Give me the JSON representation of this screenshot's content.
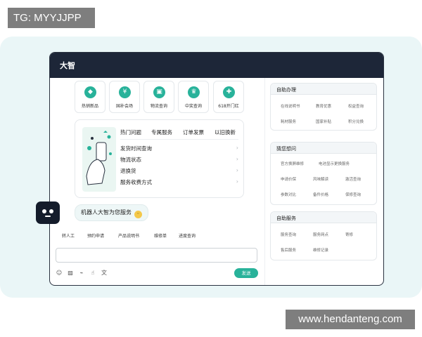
{
  "watermarks": {
    "top": "TG: MYYJJPP",
    "bottom": "www.hendanteng.com"
  },
  "window": {
    "title": "大智"
  },
  "quick_actions": [
    {
      "label": "热销新品",
      "icon": "shopping-bag-icon"
    },
    {
      "label": "国补会场",
      "icon": "subsidy-icon"
    },
    {
      "label": "物流查询",
      "icon": "delivery-box-icon"
    },
    {
      "label": "中奖查询",
      "icon": "trophy-icon"
    },
    {
      "label": "618开门红",
      "icon": "gift-icon"
    }
  ],
  "faq": {
    "tabs": [
      "热门问题",
      "专属服务",
      "订单发票",
      "以旧换新"
    ],
    "items": [
      "发货时间查询",
      "物流状态",
      "退换货",
      "服务收费方式"
    ]
  },
  "chat": {
    "greeting": "机器人大智为您服务"
  },
  "shortcuts": [
    "转人工",
    "预约申请",
    "产品说明书",
    "维修单",
    "进度查询"
  ],
  "composer": {
    "placeholder": "",
    "send_label": "发送",
    "tools": [
      "emoji-icon",
      "image-icon",
      "attachment-icon",
      "thumbs-up-icon",
      "translate-icon"
    ]
  },
  "cards": [
    {
      "title": "自助办理",
      "links": [
        "在线说明书",
        "教育优惠",
        "权益查询",
        "耗材服务",
        "国家补贴",
        "积分兑换"
      ]
    },
    {
      "title": "猜您想问",
      "links": [
        "官方换屏维修",
        "电池显示更换服务",
        "申请价保",
        "风味解读",
        "激活查询",
        "参数对比",
        "备件价格",
        "保修查询"
      ]
    },
    {
      "title": "自助服务",
      "links": [
        "服务查询",
        "服务网点",
        "寄修",
        "售后服务",
        "维修记录"
      ]
    }
  ],
  "colors": {
    "accent": "#28b29a",
    "titlebar": "#1d2638",
    "background": "#eaf6f7"
  }
}
